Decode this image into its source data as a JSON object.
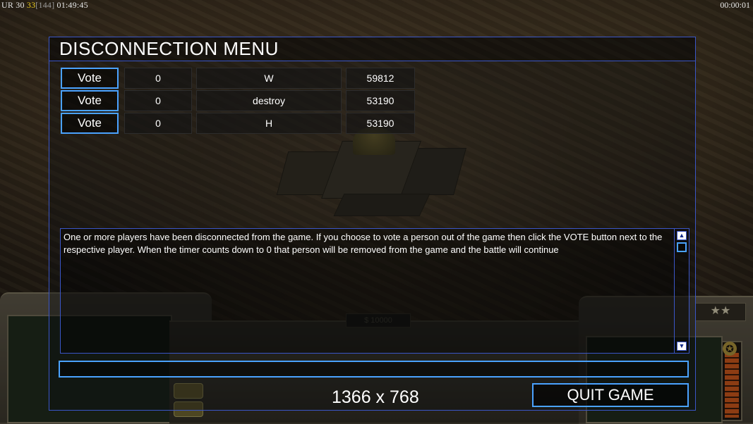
{
  "status_bar": {
    "left_prefix": "UR",
    "left_value_a": "30",
    "left_value_b": "33",
    "left_bracket": "[144]",
    "left_time": "01:49:45",
    "right_time": "00:00:01"
  },
  "hud": {
    "money": "$ 10000",
    "rank_stars": "★★"
  },
  "dialog": {
    "title": "DISCONNECTION MENU",
    "players": [
      {
        "vote_label": "Vote",
        "votes": "0",
        "name": "W",
        "ping": "59812"
      },
      {
        "vote_label": "Vote",
        "votes": "0",
        "name": "destroy",
        "ping": "53190"
      },
      {
        "vote_label": "Vote",
        "votes": "0",
        "name": "H",
        "ping": "53190"
      }
    ],
    "message": "One or more players have been disconnected from the game. If you choose to vote a person out of the game then click the VOTE button next to the respective player. When the timer counts down to 0 that person will be removed from the game and the battle will continue",
    "chat_input_value": "",
    "resolution_label": "1366 x 768",
    "quit_label": "QUIT GAME"
  },
  "colors": {
    "accent_border": "#4aa2ff",
    "frame_border": "#3a56c8",
    "highlight_number": "#f0d020"
  }
}
